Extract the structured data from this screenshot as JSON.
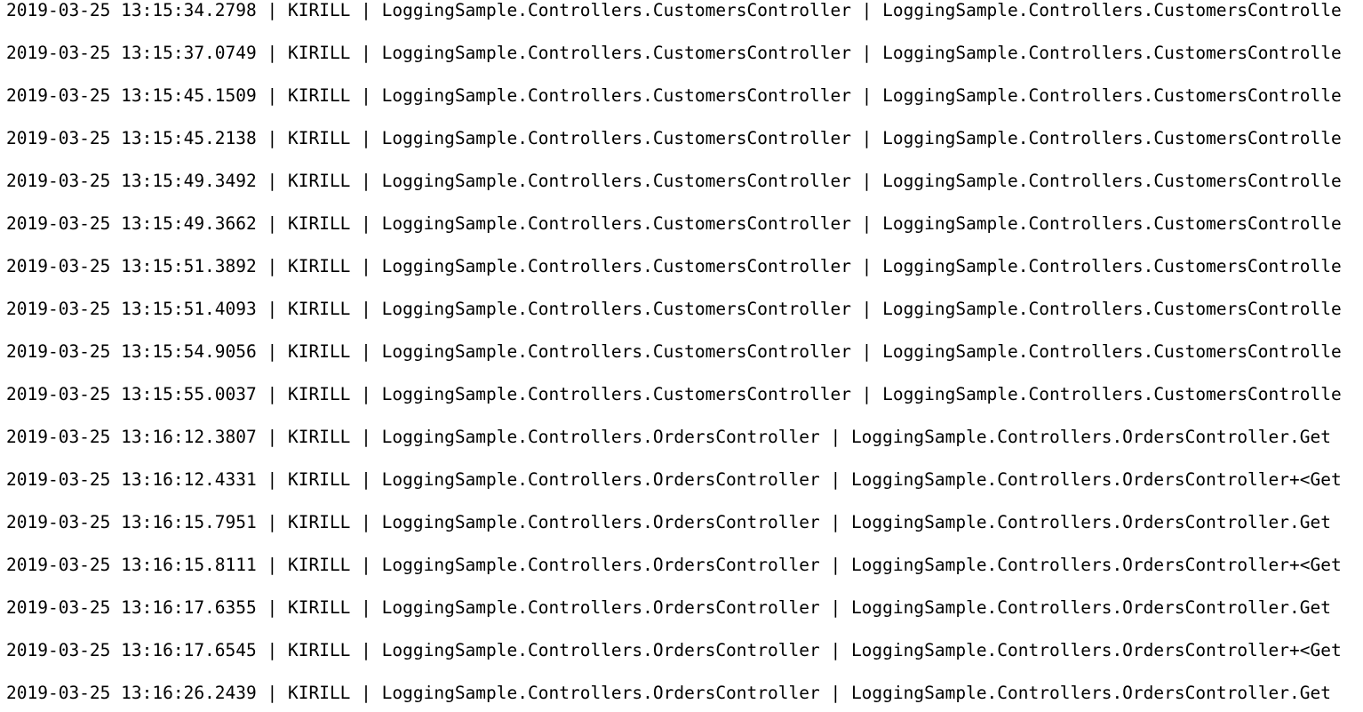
{
  "log": {
    "lines": [
      "2019-03-25 13:15:34.2798 | KIRILL | LoggingSample.Controllers.CustomersController | LoggingSample.Controllers.CustomersControlle",
      "2019-03-25 13:15:37.0749 | KIRILL | LoggingSample.Controllers.CustomersController | LoggingSample.Controllers.CustomersControlle",
      "2019-03-25 13:15:45.1509 | KIRILL | LoggingSample.Controllers.CustomersController | LoggingSample.Controllers.CustomersControlle",
      "2019-03-25 13:15:45.2138 | KIRILL | LoggingSample.Controllers.CustomersController | LoggingSample.Controllers.CustomersControlle",
      "2019-03-25 13:15:49.3492 | KIRILL | LoggingSample.Controllers.CustomersController | LoggingSample.Controllers.CustomersControlle",
      "2019-03-25 13:15:49.3662 | KIRILL | LoggingSample.Controllers.CustomersController | LoggingSample.Controllers.CustomersControlle",
      "2019-03-25 13:15:51.3892 | KIRILL | LoggingSample.Controllers.CustomersController | LoggingSample.Controllers.CustomersControlle",
      "2019-03-25 13:15:51.4093 | KIRILL | LoggingSample.Controllers.CustomersController | LoggingSample.Controllers.CustomersControlle",
      "2019-03-25 13:15:54.9056 | KIRILL | LoggingSample.Controllers.CustomersController | LoggingSample.Controllers.CustomersControlle",
      "2019-03-25 13:15:55.0037 | KIRILL | LoggingSample.Controllers.CustomersController | LoggingSample.Controllers.CustomersControlle",
      "2019-03-25 13:16:12.3807 | KIRILL | LoggingSample.Controllers.OrdersController | LoggingSample.Controllers.OrdersController.Get",
      "2019-03-25 13:16:12.4331 | KIRILL | LoggingSample.Controllers.OrdersController | LoggingSample.Controllers.OrdersController+<Get",
      "2019-03-25 13:16:15.7951 | KIRILL | LoggingSample.Controllers.OrdersController | LoggingSample.Controllers.OrdersController.Get",
      "2019-03-25 13:16:15.8111 | KIRILL | LoggingSample.Controllers.OrdersController | LoggingSample.Controllers.OrdersController+<Get",
      "2019-03-25 13:16:17.6355 | KIRILL | LoggingSample.Controllers.OrdersController | LoggingSample.Controllers.OrdersController.Get",
      "2019-03-25 13:16:17.6545 | KIRILL | LoggingSample.Controllers.OrdersController | LoggingSample.Controllers.OrdersController+<Get",
      "2019-03-25 13:16:26.2439 | KIRILL | LoggingSample.Controllers.OrdersController | LoggingSample.Controllers.OrdersController.Get"
    ]
  }
}
